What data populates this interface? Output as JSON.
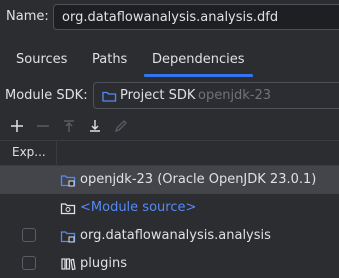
{
  "name_field": {
    "label": "Name:",
    "value": "org.dataflowanalysis.analysis.dfd"
  },
  "tabs": [
    {
      "label": "Sources"
    },
    {
      "label": "Paths"
    },
    {
      "label": "Dependencies",
      "active": true
    }
  ],
  "sdk": {
    "label": "Module SDK:",
    "value": "Project SDK",
    "sub": "openjdk-23"
  },
  "toolbar": {
    "icons": [
      "add-icon",
      "remove-icon",
      "move-up-icon",
      "move-down-icon",
      "edit-icon"
    ]
  },
  "table": {
    "column_export": "Exp...",
    "rows": [
      {
        "text": "openjdk-23 (Oracle OpenJDK 23.0.1)",
        "icon": "jdk-folder-icon",
        "selected": true
      },
      {
        "text": "<Module source>",
        "icon": "source-folder-icon",
        "link": true
      },
      {
        "text": "org.dataflowanalysis.analysis",
        "icon": "module-folder-icon",
        "checkbox": true
      },
      {
        "text": "plugins",
        "icon": "library-icon",
        "checkbox": true
      }
    ]
  },
  "colors": {
    "background": "#2b2d30",
    "accent": "#3574f0",
    "link": "#548af7",
    "selected_row": "#43454a"
  }
}
